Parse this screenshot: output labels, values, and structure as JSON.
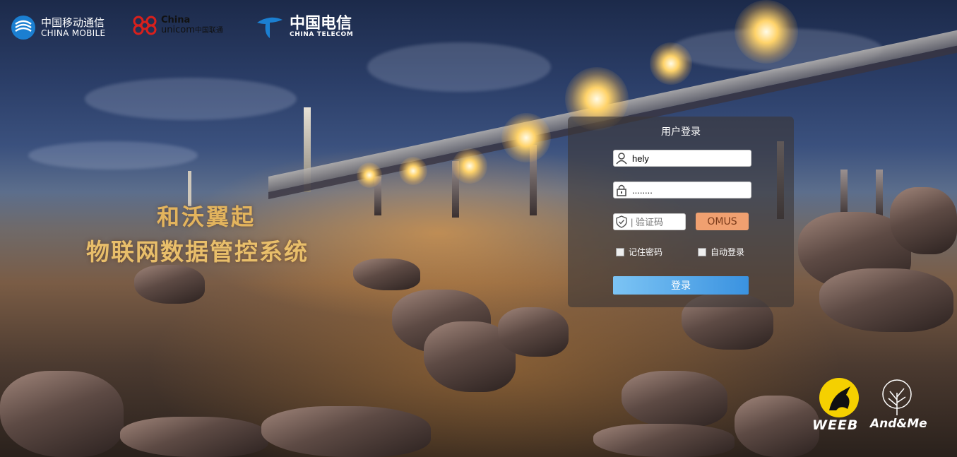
{
  "carriers": {
    "china_mobile": {
      "cn": "中国移动通信",
      "en": "CHINA MOBILE"
    },
    "china_unicom": {
      "en_top": "China",
      "en_bottom": "unicom",
      "cn": "中国联通"
    },
    "china_telecom": {
      "cn": "中国电信",
      "en": "CHINA TELECOM"
    }
  },
  "hero": {
    "line1": "和沃翼起",
    "line2": "物联网数据管控系统"
  },
  "login": {
    "title": "用户登录",
    "username": "hely",
    "password": "........",
    "captcha_placeholder": "| 验证码",
    "captcha_code": "OMUS",
    "remember_password": "记住密码",
    "auto_login": "自动登录",
    "submit": "登录"
  },
  "brands": {
    "weeb": "WEEB",
    "andme": "And&Me"
  },
  "colors": {
    "title_gold": "#e3b45d",
    "button_blue": "#3a92e0",
    "captcha_bg": "#f0a070",
    "mobile_blue": "#1b7fd1",
    "unicom_red": "#d8201c"
  }
}
